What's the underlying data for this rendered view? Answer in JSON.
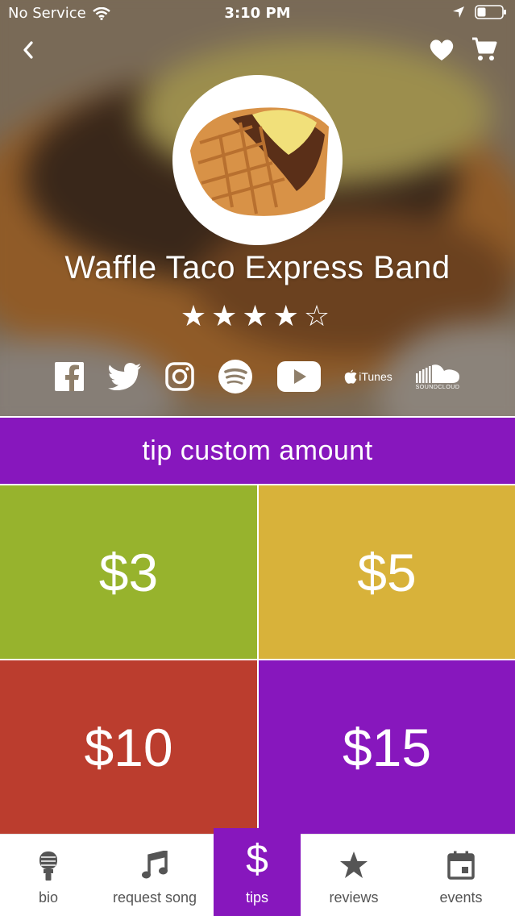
{
  "status_bar": {
    "carrier": "No Service",
    "time": "3:10 PM",
    "wifi_icon": "wifi-icon",
    "location_icon": "location-arrow-icon",
    "battery_icon": "battery-icon"
  },
  "nav": {
    "back_icon": "chevron-left-icon",
    "favorite_icon": "heart-icon",
    "cart_icon": "cart-icon"
  },
  "band": {
    "name": "Waffle Taco Express Band",
    "rating": 4,
    "rating_max": 5,
    "stars_text": "★★★★☆"
  },
  "socials": [
    {
      "name": "facebook-icon"
    },
    {
      "name": "twitter-icon"
    },
    {
      "name": "instagram-icon"
    },
    {
      "name": "spotify-icon"
    },
    {
      "name": "youtube-icon"
    },
    {
      "name": "itunes-icon",
      "label": "iTunes"
    },
    {
      "name": "soundcloud-icon",
      "label": "SOUNDCLOUD"
    }
  ],
  "tips": {
    "custom_label": "tip custom amount",
    "amounts": [
      "$3",
      "$5",
      "$10",
      "$15"
    ],
    "colors": [
      "#97b32d",
      "#d8b23a",
      "#bb3d2e",
      "#8717bd"
    ]
  },
  "tabbar": {
    "active": "tips",
    "accent": "#8717bd",
    "items": [
      {
        "label": "bio",
        "icon": "microphone-icon"
      },
      {
        "label": "request song",
        "icon": "music-note-icon"
      },
      {
        "label": "tips",
        "icon": "dollar-icon"
      },
      {
        "label": "reviews",
        "icon": "star-icon"
      },
      {
        "label": "events",
        "icon": "calendar-icon"
      }
    ]
  }
}
